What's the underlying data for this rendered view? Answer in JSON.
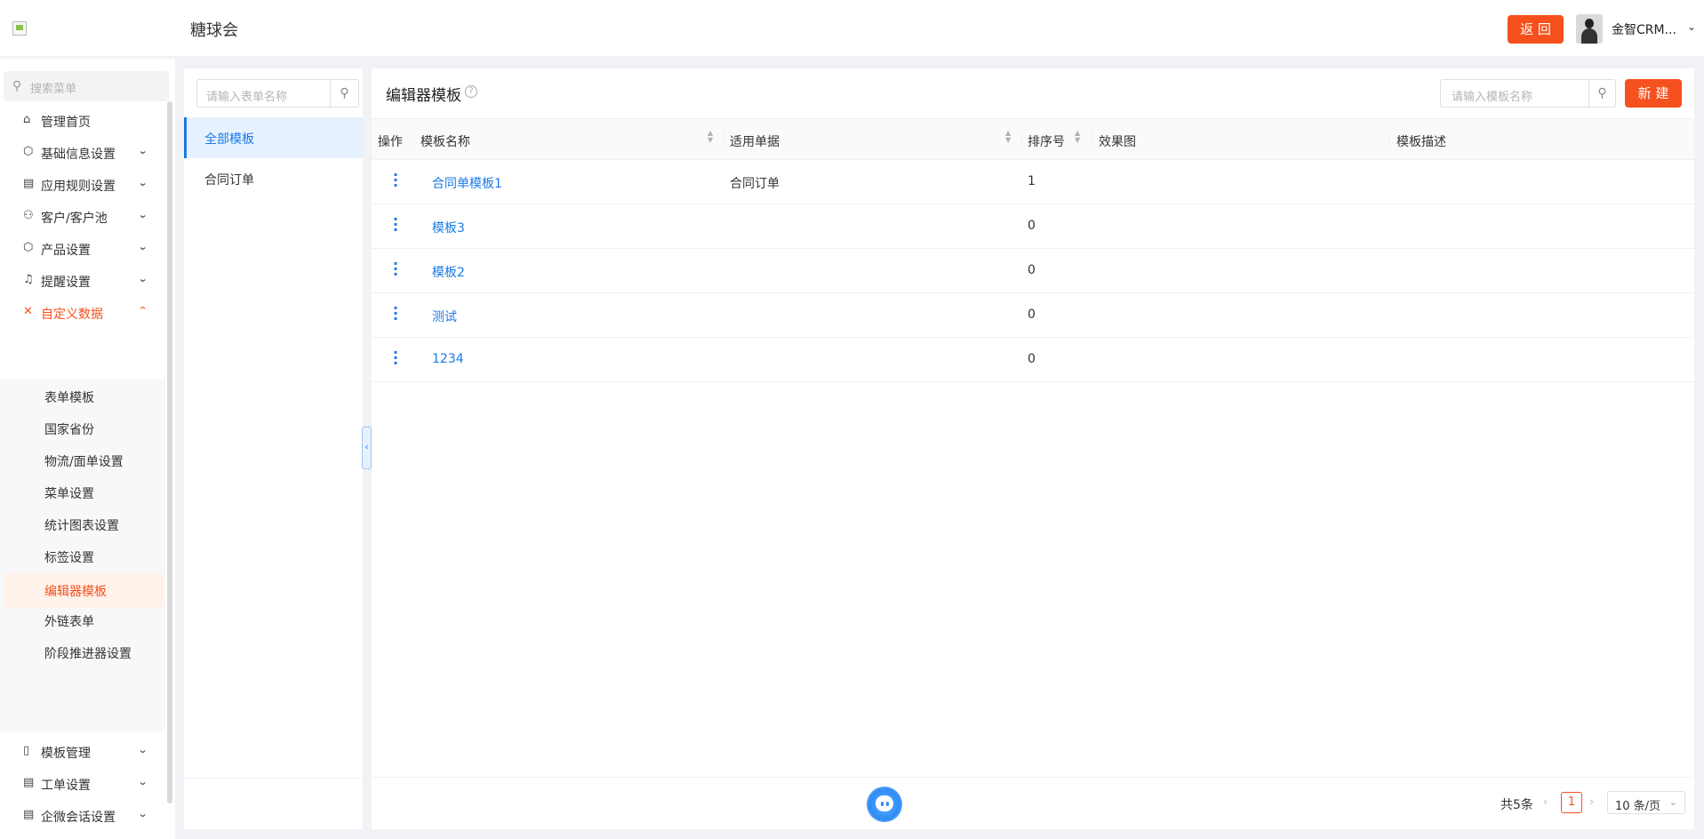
{
  "header": {
    "title": "糖球会",
    "back_label": "返 回",
    "user_name": "金智CRM...",
    "user_chevron": "⌄"
  },
  "nav": {
    "search_placeholder": "搜索菜单",
    "items_top": [
      {
        "label": "管理首页",
        "icon": "home-icon",
        "glyph": "⌂",
        "chevron": ""
      },
      {
        "label": "基础信息设置",
        "icon": "cube-icon",
        "glyph": "⬡",
        "chevron": "⌄"
      },
      {
        "label": "应用规则设置",
        "icon": "document-icon",
        "glyph": "▤",
        "chevron": "⌄"
      },
      {
        "label": "客户/客户池",
        "icon": "users-icon",
        "glyph": "⚇",
        "chevron": "⌄"
      },
      {
        "label": "产品设置",
        "icon": "box-icon",
        "glyph": "⬡",
        "chevron": "⌄"
      },
      {
        "label": "提醒设置",
        "icon": "bell-icon",
        "glyph": "♫",
        "chevron": "⌄"
      },
      {
        "label": "自定义数据",
        "icon": "tools-icon",
        "glyph": "✕",
        "chevron": "⌃"
      }
    ],
    "sub_items": [
      "表单模板",
      "国家省份",
      "物流/面单设置",
      "菜单设置",
      "统计图表设置",
      "标签设置",
      "编辑器模板",
      "外链表单",
      "阶段推进器设置"
    ],
    "items_bottom": [
      {
        "label": "模板管理",
        "icon": "layout-icon",
        "glyph": "▯",
        "chevron": "⌄"
      },
      {
        "label": "工单设置",
        "icon": "ticket-icon",
        "glyph": "▤",
        "chevron": "⌄"
      },
      {
        "label": "企微会话设置",
        "icon": "chat-icon",
        "glyph": "▤",
        "chevron": "⌄"
      }
    ]
  },
  "categories": {
    "search_placeholder": "请输入表单名称",
    "items": [
      "全部模板",
      "合同订单"
    ]
  },
  "main": {
    "title": "编辑器模板",
    "search_placeholder": "请输入模板名称",
    "new_label": "新 建",
    "columns": [
      "操作",
      "模板名称",
      "适用单据",
      "排序号",
      "效果图",
      "模板描述"
    ],
    "rows": [
      {
        "name": "合同单模板1",
        "doc": "合同订单",
        "sort": "1"
      },
      {
        "name": "模板3",
        "doc": "",
        "sort": "0"
      },
      {
        "name": "模板2",
        "doc": "",
        "sort": "0"
      },
      {
        "name": "测试",
        "doc": "",
        "sort": "0"
      },
      {
        "name": "1234",
        "doc": "",
        "sort": "0"
      }
    ]
  },
  "pagination": {
    "total": "共5条",
    "current": "1",
    "page_size": "10 条/页"
  }
}
